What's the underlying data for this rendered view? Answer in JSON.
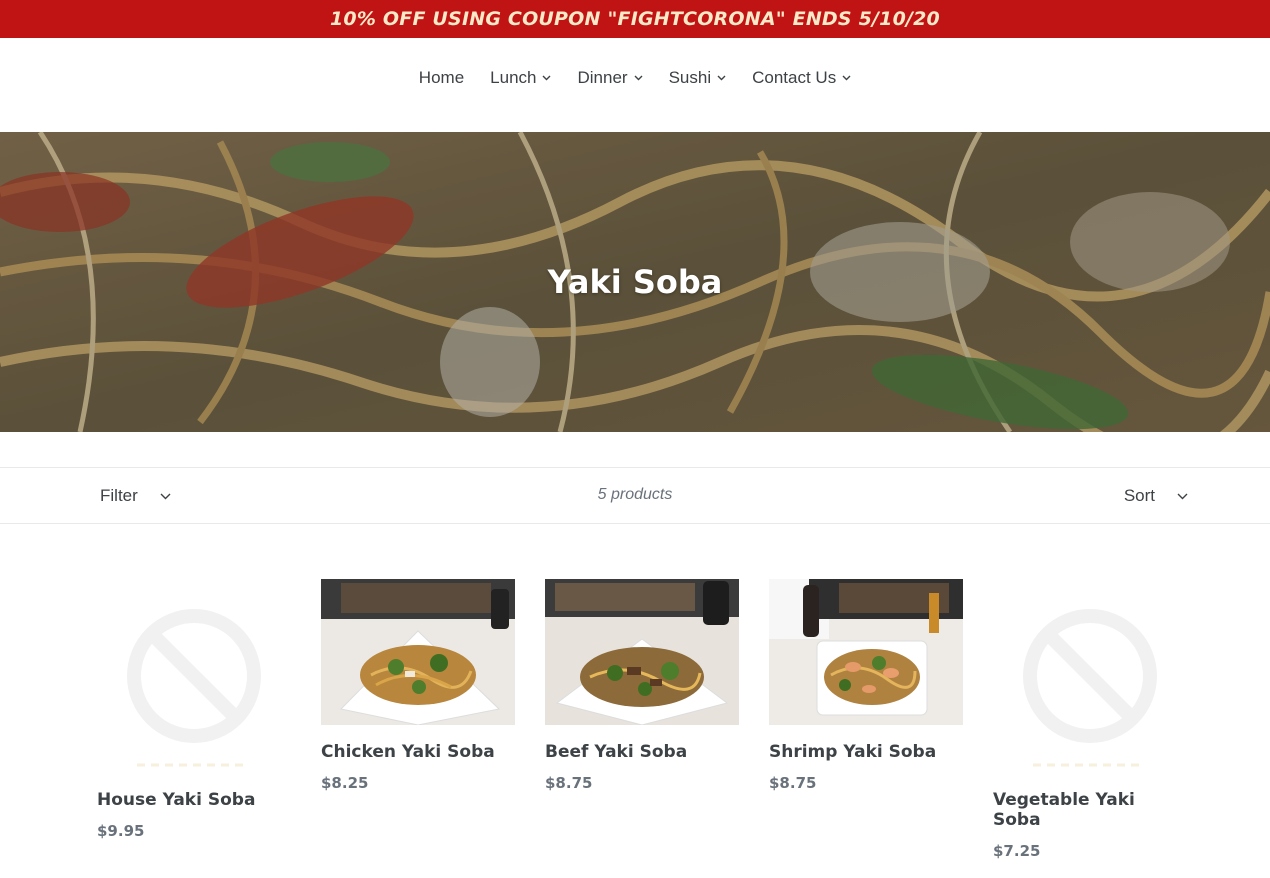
{
  "announcement": "10% OFF USING COUPON \"FIGHTCORONA\" ENDS 5/10/20",
  "nav": [
    {
      "label": "Home"
    },
    {
      "label": "Lunch"
    },
    {
      "label": "Dinner"
    },
    {
      "label": "Sushi"
    },
    {
      "label": "Contact Us"
    }
  ],
  "hero": {
    "title": "Yaki Soba"
  },
  "toolbar": {
    "filter_label": "Filter",
    "product_count": "5 products",
    "sort_label": "Sort"
  },
  "products": [
    {
      "title": "House Yaki Soba",
      "price": "$9.95",
      "image": "placeholder-icon"
    },
    {
      "title": "Chicken Yaki Soba",
      "price": "$8.25",
      "image": "food-photo"
    },
    {
      "title": "Beef Yaki Soba",
      "price": "$8.75",
      "image": "food-photo"
    },
    {
      "title": "Shrimp Yaki Soba",
      "price": "$8.75",
      "image": "food-photo"
    },
    {
      "title": "Vegetable Yaki Soba",
      "price": "$7.25",
      "image": "placeholder-icon"
    }
  ],
  "colors": {
    "announcement_bg": "#c01414",
    "announcement_text": "#fbe9c8",
    "text": "#3d4246",
    "muted": "#69727b"
  }
}
